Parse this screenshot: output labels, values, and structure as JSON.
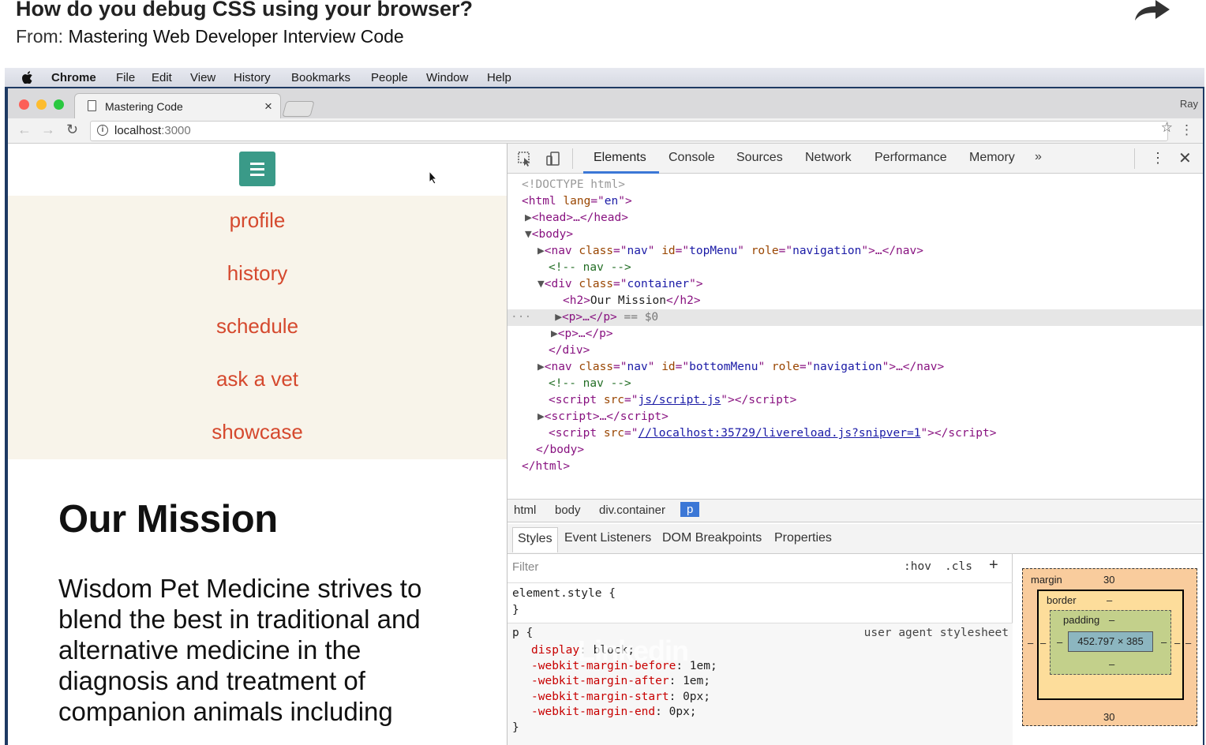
{
  "header": {
    "title": "How do you debug CSS using your browser?",
    "from_label": "From:",
    "source": "Mastering Web Developer Interview Code"
  },
  "menubar": {
    "items": [
      "Chrome",
      "File",
      "Edit",
      "View",
      "History",
      "Bookmarks",
      "People",
      "Window",
      "Help"
    ]
  },
  "browser": {
    "tab_title": "Mastering Code",
    "user": "Ray",
    "url_host": "localhost",
    "url_port": ":3000"
  },
  "page": {
    "nav_links": [
      "profile",
      "history",
      "schedule",
      "ask a vet",
      "showcase"
    ],
    "heading": "Our Mission",
    "paragraph": "Wisdom Pet Medicine strives to blend the best in traditional and alternative medicine in the diagnosis and treatment of companion animals including"
  },
  "devtools": {
    "tabs": [
      "Elements",
      "Console",
      "Sources",
      "Network",
      "Performance",
      "Memory"
    ],
    "more": "»",
    "dom": {
      "doctype": "<!DOCTYPE html>",
      "html_tag": "html",
      "lang_attr": "lang",
      "lang_val": "en",
      "head": "head",
      "body": "body",
      "nav_class": "nav",
      "top_id": "topMenu",
      "role": "navigation",
      "comment": "<!-- nav -->",
      "container": "container",
      "h2_text": "Our Mission",
      "selected_marker": "== $0",
      "bottom_id": "bottomMenu",
      "script_src": "js/script.js",
      "livereload": "//localhost:35729/livereload.js?snipver=1"
    },
    "breadcrumbs": [
      "html",
      "body",
      "div.container",
      "p"
    ],
    "styles_tabs": [
      "Styles",
      "Event Listeners",
      "DOM Breakpoints",
      "Properties"
    ],
    "styles": {
      "filter_placeholder": "Filter",
      "hov": ":hov",
      "cls": ".cls",
      "element_style": "element.style {",
      "close_brace": "}",
      "p_selector": "p {",
      "ua_label": "user agent stylesheet",
      "declarations": [
        {
          "prop": "display",
          "value": "block;"
        },
        {
          "prop": "-webkit-margin-before",
          "value": "1em;"
        },
        {
          "prop": "-webkit-margin-after",
          "value": "1em;"
        },
        {
          "prop": "-webkit-margin-start",
          "value": "0px;"
        },
        {
          "prop": "-webkit-margin-end",
          "value": "0px;"
        }
      ]
    },
    "box_model": {
      "margin_label": "margin",
      "margin_top": "30",
      "margin_bottom": "30",
      "border_label": "border",
      "border_val": "–",
      "padding_label": "padding",
      "padding_val": "–",
      "content": "452.797 × 385",
      "side_dash": "–"
    }
  },
  "watermark": "Linkedin",
  "colors": {
    "nav_link": "#d5492e",
    "nav_bg": "#f8f4ea",
    "hamburger": "#3a9a88",
    "devtools_accent": "#3b77d6"
  }
}
